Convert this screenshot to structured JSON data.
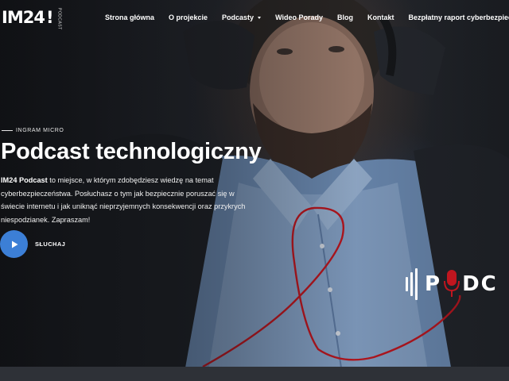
{
  "header": {
    "logo_text": "IM24",
    "logo_mark": "!",
    "logo_sub": "PODCAST",
    "nav": [
      {
        "label": "Strona główna",
        "has_dropdown": false
      },
      {
        "label": "O projekcie",
        "has_dropdown": false
      },
      {
        "label": "Podcasty",
        "has_dropdown": true
      },
      {
        "label": "Wideo Porady",
        "has_dropdown": false
      },
      {
        "label": "Blog",
        "has_dropdown": false
      },
      {
        "label": "Kontakt",
        "has_dropdown": false
      },
      {
        "label": "Bezpłatny raport cyberbezpieczeństwa",
        "has_dropdown": false
      }
    ]
  },
  "hero": {
    "eyebrow": "INGRAM MICRO",
    "title": "Podcast technologiczny",
    "description_strong": "IM24 Podcast",
    "description_rest": " to miejsce, w którym zdobędziesz wiedzę na temat cyberbezpieczeństwa. Posłuchasz o tym jak bezpiecznie poruszać się w świecie internetu i jak uniknąć nieprzyjemnych konsekwencji oraz przykrych niespodzianek. Zapraszam!",
    "listen_label": "SŁUCHAJ",
    "play_icon": "play-icon",
    "badge_text": "PODC"
  },
  "colors": {
    "accent_blue": "#3c7fd6",
    "red_cable": "#c0161f",
    "text": "#ffffff"
  }
}
